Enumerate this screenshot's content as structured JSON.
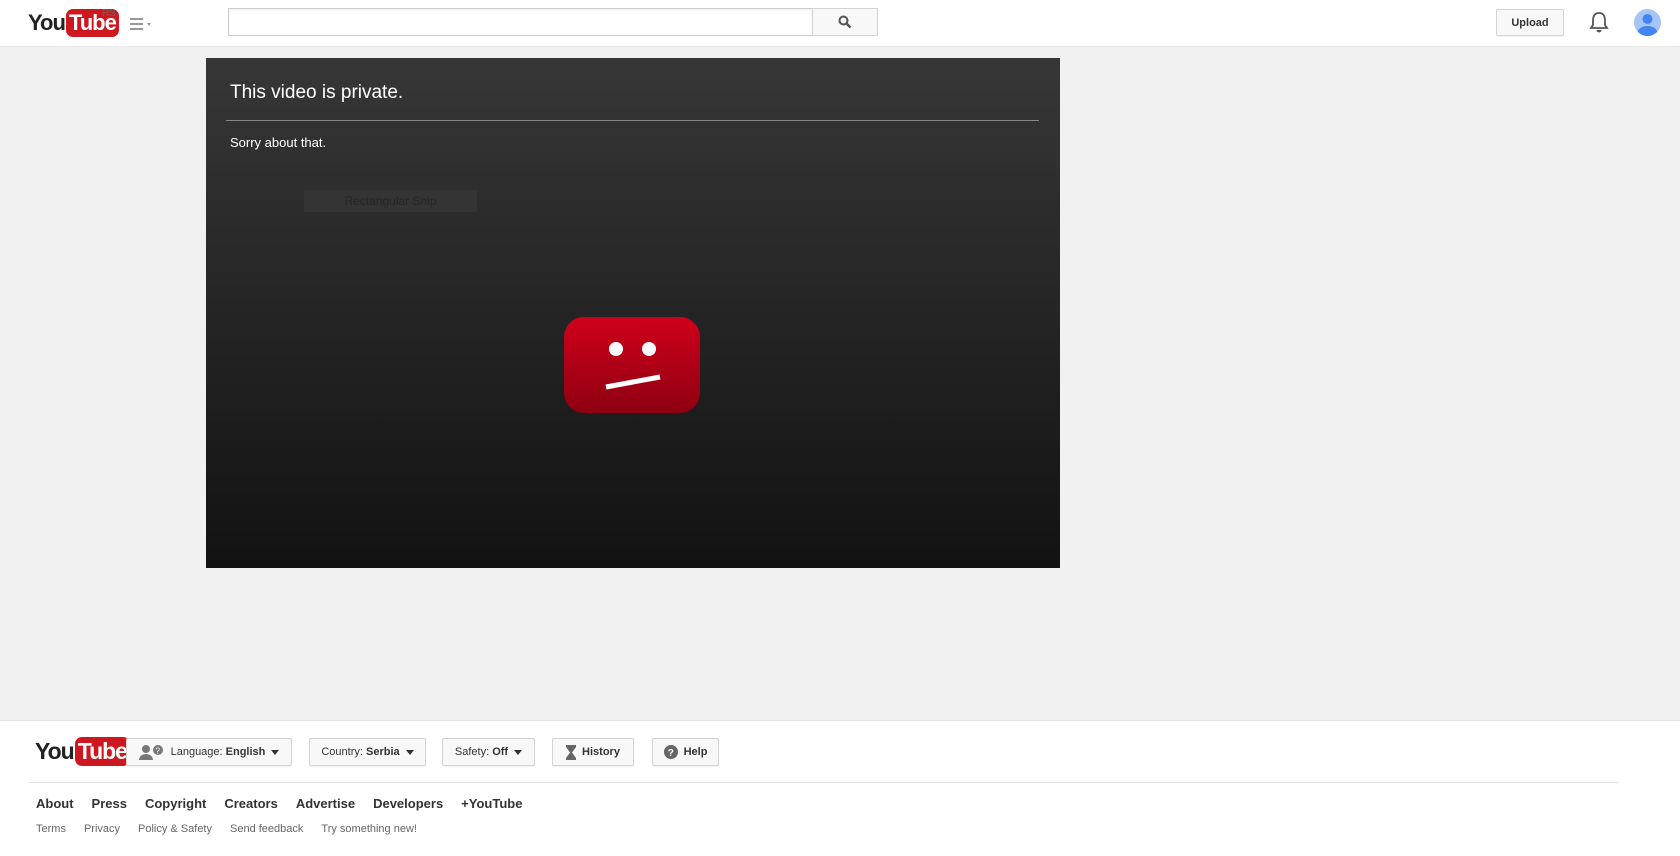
{
  "header": {
    "logo": {
      "you": "You",
      "tube": "Tube"
    },
    "country_code": "RS",
    "search_placeholder": "",
    "upload_label": "Upload"
  },
  "player": {
    "title": "This video is private.",
    "message": "Sorry about that.",
    "snip_overlay": "Rectangular Snip"
  },
  "footer": {
    "logo": {
      "you": "You",
      "tube": "Tube"
    },
    "language": {
      "label": "Language:",
      "value": "English"
    },
    "country": {
      "label": "Country:",
      "value": "Serbia"
    },
    "safety": {
      "label": "Safety:",
      "value": "Off"
    },
    "history_label": "History",
    "help_label": "Help",
    "primary_links": [
      "About",
      "Press",
      "Copyright",
      "Creators",
      "Advertise",
      "Developers",
      "+YouTube"
    ],
    "secondary_links": [
      "Terms",
      "Privacy",
      "Policy & Safety",
      "Send feedback",
      "Try something new!"
    ]
  },
  "colors": {
    "brand": "#cc181e"
  }
}
